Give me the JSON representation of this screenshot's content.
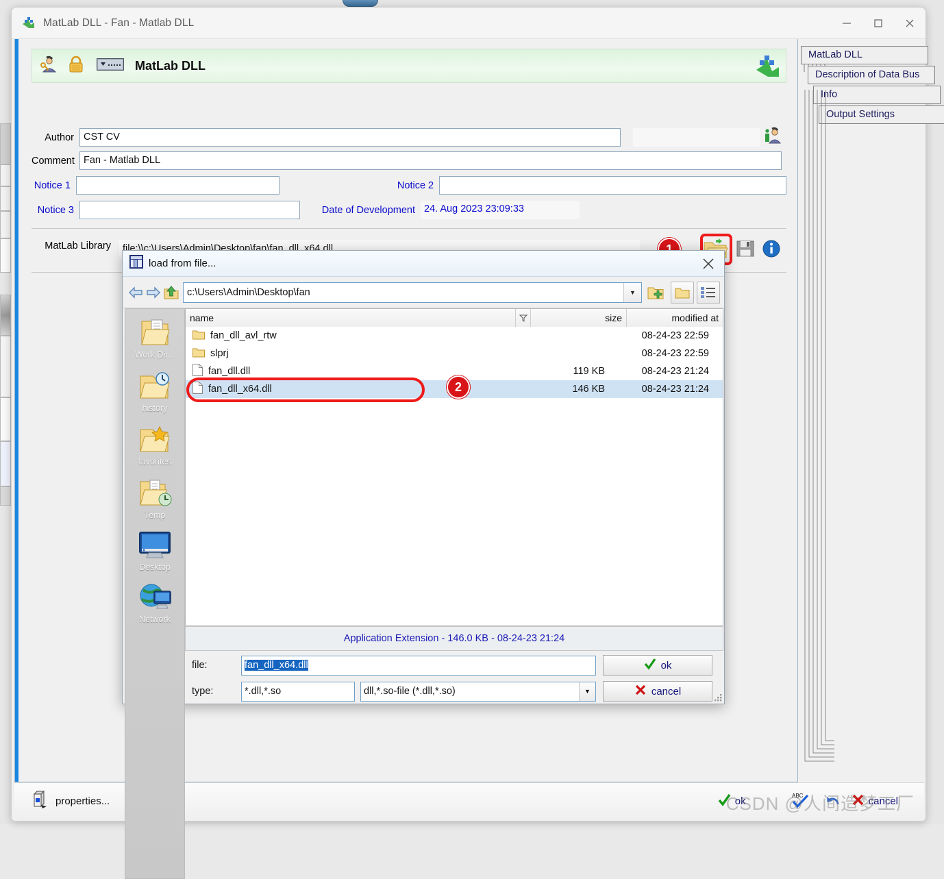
{
  "window": {
    "title": "MatLab DLL - Fan - Matlab DLL",
    "app_icon": "matlab-icon",
    "minimize_label": "—",
    "maximize_label": "□",
    "close_label": "✕"
  },
  "header": {
    "title": "MatLab DLL",
    "user_icon": "user-key-icon",
    "lock_icon": "padlock-icon",
    "keyboard_icon": "device-icon",
    "logo_icon": "matlab-logo-icon"
  },
  "form": {
    "author_label": "Author",
    "author_value": "CST CV",
    "author_icon": "user-info-icon",
    "comment_label": "Comment",
    "comment_value": "Fan - Matlab DLL",
    "notice1_label": "Notice 1",
    "notice1_value": "",
    "notice2_label": "Notice 2",
    "notice2_value": "",
    "notice3_label": "Notice 3",
    "notice3_value": "",
    "date_label": "Date of Development",
    "date_value": "24. Aug 2023 23:09:33",
    "library_label": "MatLab Library",
    "library_value": "file:\\\\c:\\Users\\Admin\\Desktop\\fan\\fan_dll_x64.dll",
    "open_icon": "open-folder-icon",
    "save_icon": "save-disk-icon",
    "info_icon": "info-icon"
  },
  "callouts": [
    {
      "number": "1"
    },
    {
      "number": "2"
    }
  ],
  "side_tabs": [
    {
      "label": "MatLab DLL"
    },
    {
      "label": "Description of Data Bus"
    },
    {
      "label": "Info"
    },
    {
      "label": "Output Settings"
    }
  ],
  "bottom_bar": {
    "properties_label": "properties...",
    "properties_icon": "properties-icon",
    "ok_label": "ok",
    "ok_icon": "check-icon",
    "spell_icon": "abc-check-icon",
    "undo_icon": "undo-icon",
    "cancel_label": "cancel",
    "cancel_icon": "x-icon",
    "watermark": "CSDN @人间造梦工厂"
  },
  "file_dialog": {
    "title": "load from file...",
    "title_icon": "file-dialog-icon",
    "close_label": "✕",
    "back_icon": "arrow-left-icon",
    "forward_icon": "arrow-right-icon",
    "up_icon": "arrow-up-folder-icon",
    "path_value": "c:\\Users\\Admin\\Desktop\\fan",
    "path_dropdown_icon": "chevron-down-icon",
    "new_folder_icon": "new-folder-icon",
    "folder_icon": "folder-icon",
    "list_view_icon": "list-view-icon",
    "places": [
      {
        "label": "Work Dir...",
        "icon": "work-dir-folder-icon"
      },
      {
        "label": "history",
        "icon": "history-folder-icon"
      },
      {
        "label": "favorites",
        "icon": "favorites-folder-icon"
      },
      {
        "label": "Temp",
        "icon": "temp-folder-icon"
      },
      {
        "label": "Desktop",
        "icon": "desktop-monitor-icon"
      },
      {
        "label": "Network",
        "icon": "network-globe-icon"
      }
    ],
    "columns": {
      "name": "name",
      "filter_icon": "filter-icon",
      "size": "size",
      "modified": "modified at"
    },
    "files": [
      {
        "name": "fan_dll_avl_rtw",
        "size": "",
        "modified": "08-24-23 22:59",
        "icon": "folder-icon",
        "selected": false
      },
      {
        "name": "slprj",
        "size": "",
        "modified": "08-24-23 22:59",
        "icon": "folder-icon",
        "selected": false
      },
      {
        "name": "fan_dll.dll",
        "size": "119 KB",
        "modified": "08-24-23 21:24",
        "icon": "file-icon",
        "selected": false
      },
      {
        "name": "fan_dll_x64.dll",
        "size": "146 KB",
        "modified": "08-24-23 21:24",
        "icon": "file-icon",
        "selected": true
      }
    ],
    "status": "Application Extension - 146.0 KB - 08-24-23 21:24",
    "file_label": "file:",
    "file_value": "fan_dll_x64.dll",
    "type_label": "type:",
    "type_value": "*.dll,*.so",
    "type_filter_value": "dll,*.so-file (*.dll,*.so)",
    "type_dropdown_icon": "chevron-down-icon",
    "ok_label": "ok",
    "ok_icon": "check-icon",
    "cancel_label": "cancel",
    "cancel_icon": "x-icon"
  }
}
